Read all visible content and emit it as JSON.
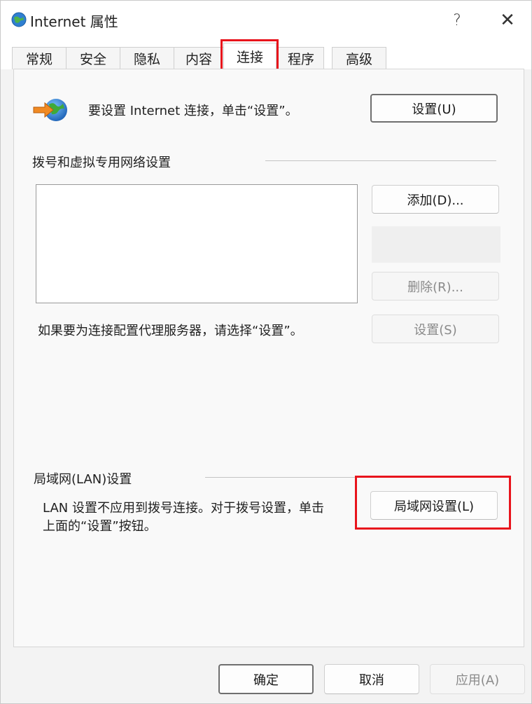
{
  "window": {
    "title": "Internet 属性",
    "help": "?",
    "close": "✕"
  },
  "tabs": [
    {
      "label": "常规"
    },
    {
      "label": "安全"
    },
    {
      "label": "隐私"
    },
    {
      "label": "内容"
    },
    {
      "label": "连接"
    },
    {
      "label": "程序"
    },
    {
      "label": "高级"
    }
  ],
  "active_tab": "连接",
  "setup": {
    "text": "要设置 Internet 连接，单击“设置”。",
    "button": "设置(U)"
  },
  "dialup": {
    "heading": "拨号和虚拟专用网络设置",
    "add_button": "添加(D)...",
    "remove_button": "删除(R)...",
    "settings_button": "设置(S)",
    "proxy_text": "如果要为连接配置代理服务器，请选择“设置”。",
    "items": []
  },
  "lan": {
    "heading": "局域网(LAN)设置",
    "text_line1": "LAN 设置不应用到拨号连接。对于拨号设置，单击",
    "text_line2": "上面的“设置”按钮。",
    "button": "局域网设置(L)"
  },
  "footer": {
    "ok": "确定",
    "cancel": "取消",
    "apply": "应用(A)"
  },
  "colors": {
    "highlight": "#e8141c",
    "window_bg": "#f3f3f3",
    "panel_bg": "#f9f9f9"
  },
  "icons": {
    "app": "internet-globe-icon",
    "connection": "globe-arrow-icon"
  }
}
